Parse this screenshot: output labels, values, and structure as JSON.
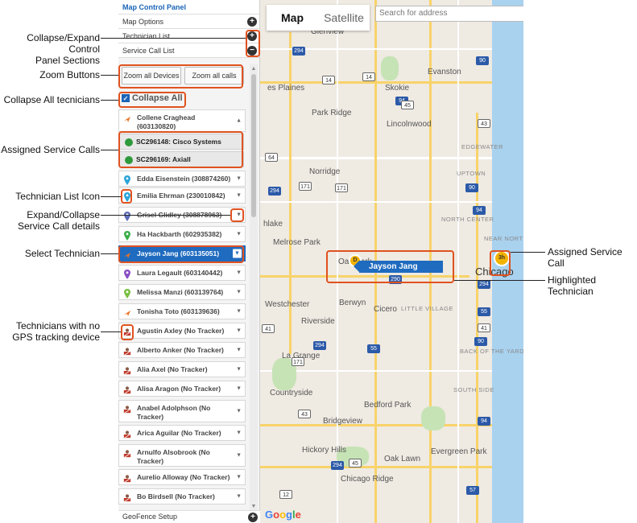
{
  "panel": {
    "title": "Map Control Panel",
    "sections": [
      "Map Options",
      "Technician List",
      "Service Call List"
    ],
    "zoom_all_devices": "Zoom all Devices",
    "zoom_all_calls": "Zoom all calls",
    "collapse_all": "Collapse All",
    "footer": "GeoFence Setup"
  },
  "technicians": [
    {
      "name": "Collene Craghead\n(603130820)",
      "icon": "arrow-icon",
      "color": "#e8742a"
    },
    {
      "name": "Edda Eisenstein (308874260)",
      "icon": "pin-icon",
      "color": "#2aa4d8"
    },
    {
      "name": "Emilia Ehrman (230010842)",
      "icon": "pin-icon",
      "color": "#2aa4d8"
    },
    {
      "name": "Grisel Glidley (308878963)",
      "icon": "pin-icon",
      "color": "#5b6bb8"
    },
    {
      "name": "Ha Hackbarth (602935382)",
      "icon": "pin-icon",
      "color": "#3cae4a"
    },
    {
      "name": "Jayson Jang (603135051)",
      "icon": "arrow-icon",
      "color": "#e8742a"
    },
    {
      "name": "Laura Legault (603140442)",
      "icon": "pin-icon",
      "color": "#8a4fc4"
    },
    {
      "name": "Melissa Manzi (603139764)",
      "icon": "pin-icon",
      "color": "#7bc043"
    },
    {
      "name": "Tonisha Toto (603139636)",
      "icon": "arrow-icon",
      "color": "#e8742a"
    },
    {
      "name": "Agustin Axley (No Tracker)",
      "icon": "truck-icon",
      "color": "#c0392b"
    },
    {
      "name": "Alberto Anker (No Tracker)",
      "icon": "truck-icon",
      "color": "#c0392b"
    },
    {
      "name": "Alia Axel (No Tracker)",
      "icon": "truck-icon",
      "color": "#c0392b"
    },
    {
      "name": "Alisa Aragon (No Tracker)",
      "icon": "truck-icon",
      "color": "#c0392b"
    },
    {
      "name": "Anabel Adolphson (No\nTracker)",
      "icon": "truck-icon",
      "color": "#c0392b"
    },
    {
      "name": "Arica Aguilar (No Tracker)",
      "icon": "truck-icon",
      "color": "#c0392b"
    },
    {
      "name": "Arnulfo Alsobrook (No\nTracker)",
      "icon": "truck-icon",
      "color": "#c0392b"
    },
    {
      "name": "Aurelio Alloway (No Tracker)",
      "icon": "truck-icon",
      "color": "#c0392b"
    },
    {
      "name": "Bo Birdsell (No Tracker)",
      "icon": "truck-icon",
      "color": "#c0392b"
    }
  ],
  "service_calls": [
    "SC296148: Cisco Systems",
    "SC296169: Axiall"
  ],
  "callouts": {
    "collapse_expand": "Collapse/Expand Control\nPanel Sections",
    "zoom_buttons": "Zoom Buttons",
    "collapse_all_techs": "Collapse All tecnicians",
    "assigned_calls": "Assigned Service Calls",
    "tech_list_icon": "Technician List Icon",
    "expand_collapse_details": "Expand/Collapse\nService Call details",
    "select_tech": "Select Technician",
    "no_gps": "Technicians with no\nGPS tracking device",
    "assigned_call": "Assigned Service Call",
    "highlighted_tech": "Highlighted Technician"
  },
  "map": {
    "map_label": "Map",
    "satellite_label": "Satellite",
    "search_placeholder": "Search for address",
    "highlighted_name": "Jayson Jang",
    "call_pin": "3h",
    "tech_pin": "D",
    "google": "Google",
    "places": [
      "Glenview",
      "Evanston",
      "Skokie",
      "es Plaines",
      "Park Ridge",
      "Lincolnwood",
      "Norridge",
      "EDGEWATER",
      "UPTOWN",
      "NORTH CENTER",
      "hlake",
      "Melrose Park",
      "Chicago",
      "NEAR NORTH SIDE",
      "Oak Park",
      "LITTLE VILLAGE",
      "Berwyn",
      "Cicero",
      "Westchester",
      "Riverside",
      "La Grange",
      "BACK OF THE YARDS",
      "Countryside",
      "SOUTH SIDE",
      "Bedford Park",
      "Bridgeview",
      "Hickory Hills",
      "Oak Lawn",
      "Evergreen Park",
      "Chicago Ridge"
    ],
    "shields": [
      "294",
      "14",
      "94",
      "14",
      "45",
      "90",
      "43",
      "171",
      "64",
      "294",
      "171",
      "90",
      "94",
      "290",
      "41",
      "55",
      "171",
      "55",
      "90",
      "294",
      "294",
      "45",
      "41",
      "294",
      "43",
      "57",
      "12",
      "94"
    ]
  }
}
